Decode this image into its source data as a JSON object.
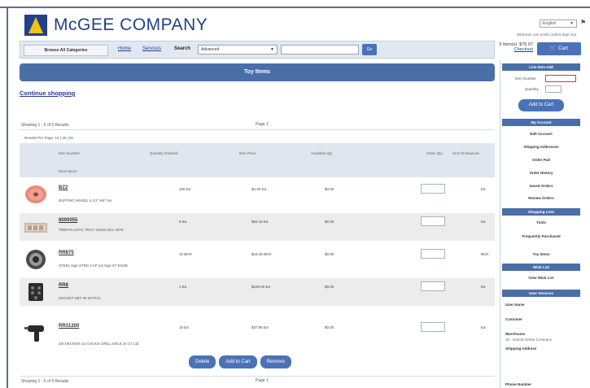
{
  "header": {
    "company_name": "McGEE COMPANY",
    "language": "English",
    "welcome_text": "Welcome Joe Smith  (1004)  Sign Out"
  },
  "nav": {
    "browse_label": "Browse All Categories",
    "home_label": "Home",
    "services_label": "Services",
    "search_label": "Search",
    "search_scope": "Advanced",
    "search_value": "",
    "go_label": "Go",
    "items_summary": "5 Item(s): $76.97",
    "checkout_label": "Checkout",
    "cart_label": "Cart"
  },
  "page": {
    "title": "Toy Items",
    "continue_label": "Continue shopping",
    "showing_text": "Showing 1 - 5 of 5 Results",
    "page_label": "Page",
    "page_number": "1",
    "results_per_page": "Results Per Page: 10 | 20 | 50"
  },
  "table": {
    "headers": {
      "item": "Item Number",
      "description": "Description",
      "qty": "Quantity Ordered",
      "price": "Item Price",
      "available": "Available Qty",
      "order_qty": "Order Qty",
      "uom": "Unit Of Measure"
    },
    "rows": [
      {
        "item": "BZ2",
        "desc": "BUFFING WHEEL 6 X1\" 5/8\" AH",
        "qty": "100  Ea",
        "price": "$4.40  Ea",
        "avail": "$0.00",
        "uom": "Ea",
        "thumb": "buffing-wheel"
      },
      {
        "item": "8000055",
        "desc": "TRIM PLASTIC TRAY 12X20 4/CL WTE",
        "qty": "5  Ea",
        "price": "$52.16  Ea",
        "avail": "$0.00",
        "uom": "Ea",
        "thumb": "plastic-tray"
      },
      {
        "item": "RR875",
        "desc": "STEEL Ng4 STRD CAP 1/4 Ng4 ST ESSB",
        "qty": "10  BOX",
        "price": "$23.48  BOX",
        "avail": "$0.00",
        "uom": "BOX",
        "thumb": "wire-spool"
      },
      {
        "item": "RR8",
        "desc": "SOCKET SET #6 20 PCS",
        "qty": "1  Ea",
        "price": "$169.00  Ea",
        "avail": "$0.00",
        "uom": "Ea",
        "thumb": "socket-set"
      },
      {
        "item": "RR31200",
        "desc": "3/8 DECKER 1/2 CHUCK DRILL ERL8 20 CT Ltd",
        "qty": "10  Ea",
        "price": "$37.95  Ea",
        "avail": "$0.00",
        "uom": "Ea",
        "thumb": "drill"
      }
    ]
  },
  "actions": {
    "delete": "Delete",
    "add_to_cart": "Add to Cart",
    "remove": "Remove"
  },
  "sidebar": {
    "quick_add_title": "Line Item Add",
    "item_number_label": "Item Number",
    "quantity_label": "Quantity",
    "quick_add_button": "Add to Cart",
    "my_account_title": "My Account",
    "account_items": [
      "Edit Account",
      "Shipping Addresses",
      "Order Pad",
      "Order History",
      "Saved Orders",
      "Review Orders"
    ],
    "shopping_title": "Shopping Lists",
    "shopping_items": [
      "Tools",
      "Frequently Purchased",
      "Toy Items"
    ],
    "wish_title": "Wish List",
    "wish_items": [
      "View Wish List"
    ],
    "user_title": "User Services",
    "user_name_label": "User Name",
    "customer_label": "Customer",
    "warehouse_label": "Warehouse",
    "warehouse_value": "10 - Detroit Online Company",
    "shipping_label": "Shipping Address",
    "phone_label": "Phone Number"
  },
  "colors": {
    "brand_blue": "#23408a",
    "accent_blue": "#4a72b8",
    "header_bar": "#4a6ea8",
    "logo_yellow": "#f2c316"
  }
}
